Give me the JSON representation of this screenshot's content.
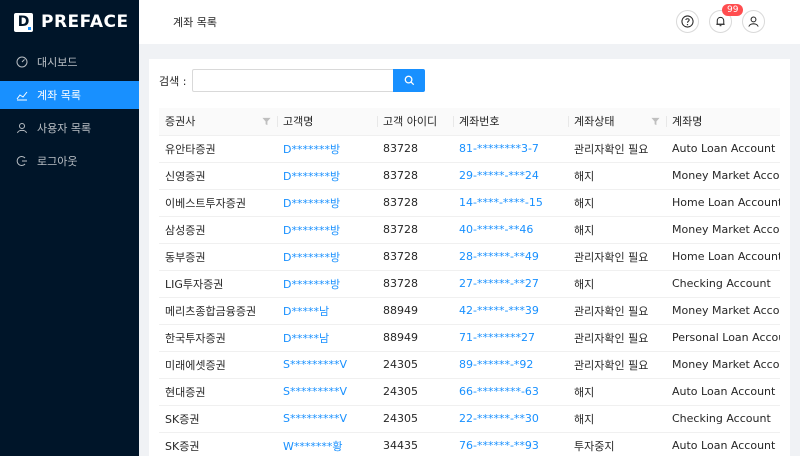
{
  "brand": {
    "logo_letter": "D",
    "name": "PREFACE"
  },
  "sidebar": {
    "items": [
      {
        "label": "대시보드",
        "icon": "dashboard-icon",
        "active": false
      },
      {
        "label": "계좌 목록",
        "icon": "chart-line-icon",
        "active": true
      },
      {
        "label": "사용자 목록",
        "icon": "user-icon",
        "active": false
      },
      {
        "label": "로그아웃",
        "icon": "logout-icon",
        "active": false
      }
    ]
  },
  "header": {
    "title": "계좌 목록",
    "notification_count": "99",
    "icons": [
      "help-icon",
      "bell-icon",
      "user-icon"
    ]
  },
  "search": {
    "label": "검색 :",
    "value": "",
    "placeholder": ""
  },
  "table": {
    "columns": [
      "증권사",
      "고객명",
      "고객 아이디",
      "계좌번호",
      "계좌상태",
      "계좌명"
    ],
    "rows": [
      [
        "유안타증권",
        "D*******방",
        "83728",
        "81-********3-7",
        "관리자확인 필요",
        "Auto Loan Account"
      ],
      [
        "신영증권",
        "D*******방",
        "83728",
        "29-*****-***24",
        "해지",
        "Money Market Account"
      ],
      [
        "이베스트투자증권",
        "D*******방",
        "83728",
        "14-****-****-15",
        "해지",
        "Home Loan Account"
      ],
      [
        "삼성증권",
        "D*******방",
        "83728",
        "40-*****-**46",
        "해지",
        "Money Market Account"
      ],
      [
        "동부증권",
        "D*******방",
        "83728",
        "28-******-**49",
        "관리자확인 필요",
        "Home Loan Account"
      ],
      [
        "LIG투자증권",
        "D*******방",
        "83728",
        "27-******-**27",
        "해지",
        "Checking Account"
      ],
      [
        "메리츠종합금융증권",
        "D*****남",
        "88949",
        "42-*****-***39",
        "관리자확인 필요",
        "Money Market Account"
      ],
      [
        "한국투자증권",
        "D*****남",
        "88949",
        "71-********27",
        "관리자확인 필요",
        "Personal Loan Account"
      ],
      [
        "미래에셋증권",
        "S*********V",
        "24305",
        "89-******-*92",
        "관리자확인 필요",
        "Money Market Account"
      ],
      [
        "현대증권",
        "S*********V",
        "24305",
        "66-********-63",
        "해지",
        "Auto Loan Account"
      ],
      [
        "SK증권",
        "S*********V",
        "24305",
        "22-******-**30",
        "해지",
        "Checking Account"
      ],
      [
        "SK증권",
        "W*******황",
        "34435",
        "76-******-**93",
        "투자중지",
        "Auto Loan Account"
      ]
    ]
  },
  "colors": {
    "sidebar_bg": "#001529",
    "accent": "#1890ff",
    "badge": "#ff4d4f"
  }
}
